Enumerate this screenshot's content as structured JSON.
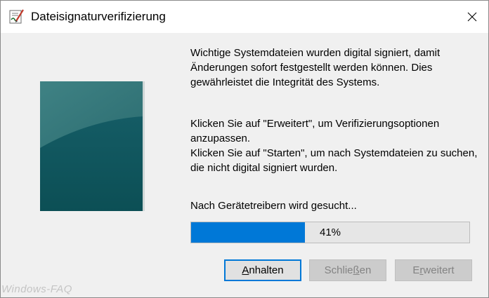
{
  "window": {
    "title": "Dateisignaturverifizierung",
    "close_symbol": "✕"
  },
  "icons": {
    "app": "signature-document-icon",
    "close": "close-icon"
  },
  "content": {
    "para1": "Wichtige Systemdateien wurden digital signiert, damit Änderungen sofort festgestellt werden können. Dies gewährleistet die Integrität des Systems.",
    "para2": "Klicken Sie auf \"Erweitert\", um Verifizierungsoptionen anzupassen.",
    "para3": "Klicken Sie auf \"Starten\", um nach Systemdateien zu suchen, die nicht digital signiert wurden.",
    "status": "Nach Gerätetreibern wird gesucht...",
    "progress_label": "41%",
    "progress_value": 41
  },
  "buttons": {
    "pause": {
      "mnemonic": "A",
      "rest": "nhalten"
    },
    "close": {
      "before": "Schlie",
      "mnemonic": "ß",
      "after": "en"
    },
    "advanced": {
      "before": "E",
      "mnemonic": "r",
      "after": "weitert"
    }
  },
  "colors": {
    "progress_fill": "#0078d7",
    "image_top": "#3c7c7e",
    "image_bottom": "#0c4f55",
    "focus_border": "#0078d7"
  },
  "watermark": "Windows-FAQ"
}
